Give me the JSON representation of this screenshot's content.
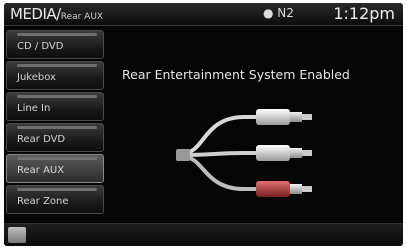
{
  "header": {
    "title": "MEDIA/",
    "subtitle": "Rear AUX",
    "signal": "● N2",
    "time": "1:12pm"
  },
  "sidebar": {
    "items": [
      {
        "label": "CD / DVD"
      },
      {
        "label": "Jukebox"
      },
      {
        "label": "Line In"
      },
      {
        "label": "Rear DVD"
      },
      {
        "label": "Rear AUX"
      },
      {
        "label": "Rear Zone"
      }
    ]
  },
  "main": {
    "message": "Rear Entertainment System Enabled",
    "graphic": "rca-cables-icon"
  },
  "footer": {
    "home_icon": "home-icon"
  },
  "colors": {
    "background": "#050505",
    "text": "#e6e6e6",
    "cable_red": "#b23a3a",
    "cable_white": "#dcdcdc"
  }
}
